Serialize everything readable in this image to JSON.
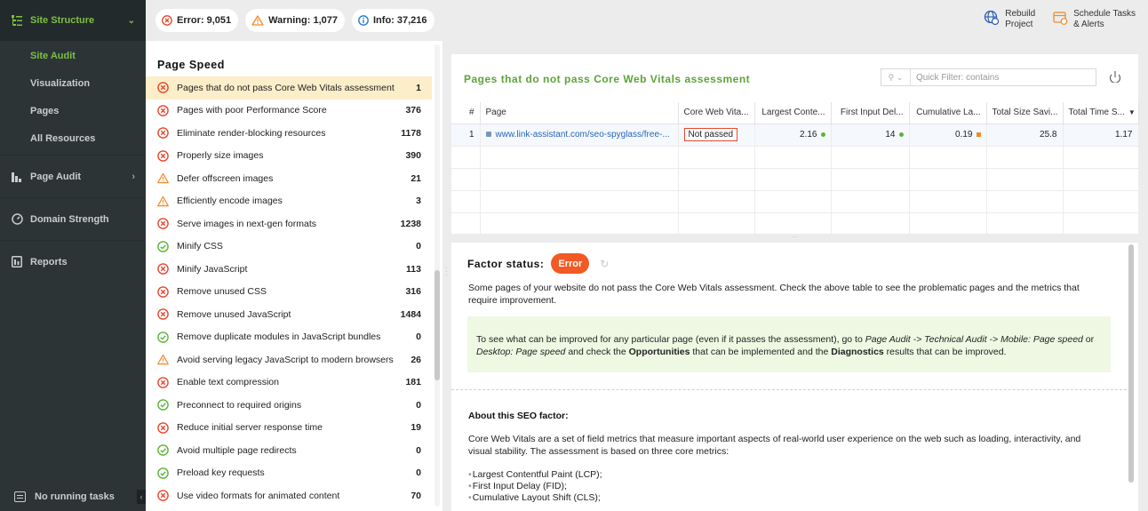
{
  "sidebar": {
    "header": "Site Structure",
    "sub_items": [
      "Site Audit",
      "Visualization",
      "Pages",
      "All Resources"
    ],
    "main_items": [
      {
        "label": "Page Audit",
        "icon": "page-audit-icon"
      },
      {
        "label": "Domain Strength",
        "icon": "gauge-icon"
      },
      {
        "label": "Reports",
        "icon": "reports-icon"
      }
    ],
    "bottom": "No running tasks",
    "accent": "#7cc043"
  },
  "topbar": {
    "error": "Error: 9,051",
    "warning": "Warning: 1,077",
    "info": "Info: 37,216",
    "rebuild_line1": "Rebuild",
    "rebuild_line2": "Project",
    "schedule_line1": "Schedule Tasks",
    "schedule_line2": "& Alerts"
  },
  "factors": {
    "title": "Page Speed",
    "items": [
      {
        "label": "Pages that do not pass Core Web Vitals assessment",
        "count": "1",
        "status": "error",
        "selected": true
      },
      {
        "label": "Pages with poor Performance Score",
        "count": "376",
        "status": "error"
      },
      {
        "label": "Eliminate render-blocking resources",
        "count": "1178",
        "status": "error"
      },
      {
        "label": "Properly size images",
        "count": "390",
        "status": "error"
      },
      {
        "label": "Defer offscreen images",
        "count": "21",
        "status": "warning"
      },
      {
        "label": "Efficiently encode images",
        "count": "3",
        "status": "warning"
      },
      {
        "label": "Serve images in next-gen formats",
        "count": "1238",
        "status": "error"
      },
      {
        "label": "Minify CSS",
        "count": "0",
        "status": "ok"
      },
      {
        "label": "Minify JavaScript",
        "count": "113",
        "status": "error"
      },
      {
        "label": "Remove unused CSS",
        "count": "316",
        "status": "error"
      },
      {
        "label": "Remove unused JavaScript",
        "count": "1484",
        "status": "error"
      },
      {
        "label": "Remove duplicate modules in JavaScript bundles",
        "count": "0",
        "status": "ok"
      },
      {
        "label": "Avoid serving legacy JavaScript to modern browsers",
        "count": "26",
        "status": "warning"
      },
      {
        "label": "Enable text compression",
        "count": "181",
        "status": "error"
      },
      {
        "label": "Preconnect to required origins",
        "count": "0",
        "status": "ok"
      },
      {
        "label": "Reduce initial server response time",
        "count": "19",
        "status": "error"
      },
      {
        "label": "Avoid multiple page redirects",
        "count": "0",
        "status": "ok"
      },
      {
        "label": "Preload key requests",
        "count": "0",
        "status": "ok"
      },
      {
        "label": "Use video formats for animated content",
        "count": "70",
        "status": "error"
      }
    ]
  },
  "table": {
    "title": "Pages that do not pass Core Web Vitals assessment",
    "filter_placeholder": "Quick Filter: contains",
    "columns": [
      "#",
      "Page",
      "Core Web Vita...",
      "Largest Conte...",
      "First Input Del...",
      "Cumulative La...",
      "Total Size Savi...",
      "Total Time S..."
    ],
    "rows": [
      {
        "num": "1",
        "page": "www.link-assistant.com/seo-spyglass/free-...",
        "cwv": "Not passed",
        "lcp": "2.16",
        "fid": "14",
        "cls": "0.19",
        "size": "25.8",
        "time": "1.17"
      }
    ]
  },
  "detail": {
    "factor_status_label": "Factor status:",
    "status": "Error",
    "description": "Some pages of your website do not pass the Core Web Vitals assessment. Check the above table to see the problematic pages and the metrics that require improvement.",
    "hint_a": "To see what can be improved for any particular page (even if it passes the assessment), go to ",
    "hint_path1": "Page Audit -> Technical Audit -> Mobile: Page speed",
    "hint_or": " or ",
    "hint_path2": "Desktop: Page speed",
    "hint_b": " and check the ",
    "hint_opps": "Opportunities",
    "hint_c": " that can be implemented and the ",
    "hint_diag": "Diagnostics",
    "hint_d": " results that can be improved.",
    "about_title": "About this SEO factor:",
    "about_text": "Core Web Vitals are a set of field metrics that measure important aspects of real-world user experience on the web such as loading, interactivity, and visual stability. The assessment is based on three core metrics:",
    "metrics": [
      "Largest Contentful Paint (LCP);",
      "First Input Delay (FID);",
      "Cumulative Layout Shift (CLS);"
    ]
  },
  "colors": {
    "error": "#e8472e",
    "warning": "#f18a2b",
    "ok": "#5cb336",
    "title_green": "#5ea33a"
  }
}
